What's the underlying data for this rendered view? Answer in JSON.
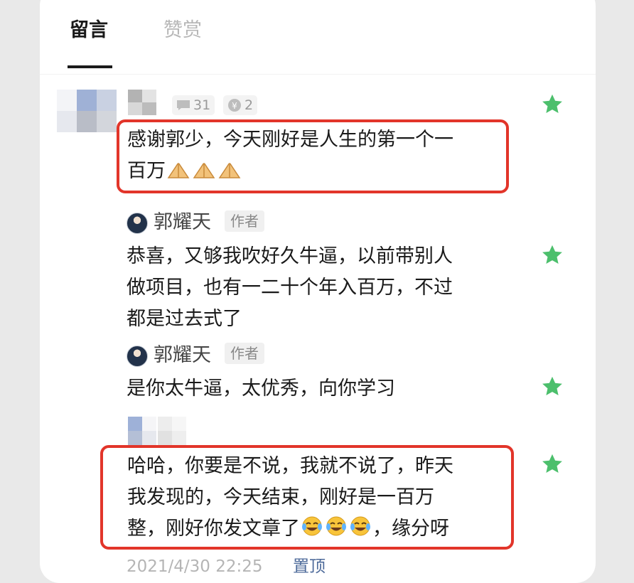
{
  "tabs": [
    {
      "label": "留言",
      "active": true
    },
    {
      "label": "赞赏",
      "active": false
    }
  ],
  "comment1": {
    "reply_count": "31",
    "reward_count": "2",
    "text_line1": "感谢郭少，今天刚好是人生的第一个一",
    "text_line2": "百万",
    "emoji": "folded-hands-icon"
  },
  "reply1": {
    "author": "郭耀天",
    "badge": "作者",
    "lines": [
      "恭喜，又够我吹好久牛逼，以前带别人",
      "做项目，也有一二十个年入百万，不过",
      "都是过去式了"
    ]
  },
  "reply2": {
    "author": "郭耀天",
    "badge": "作者",
    "lines": [
      "是你太牛逼，太优秀，向你学习"
    ]
  },
  "comment2": {
    "text_line1": "哈哈，你要是不说，我就不说了，昨天",
    "text_line2": "我发现的，今天结束，刚好是一百万",
    "text_line3_a": "整，刚好你发文章了",
    "text_line3_b": "，缘分呀",
    "emoji": "tears-of-joy-icon",
    "timestamp": "2021/4/30 22:25",
    "pin_label": "置顶"
  },
  "colors": {
    "highlight": "#e2352a",
    "star": "#4cbf6c",
    "link": "#4d6a9a"
  }
}
